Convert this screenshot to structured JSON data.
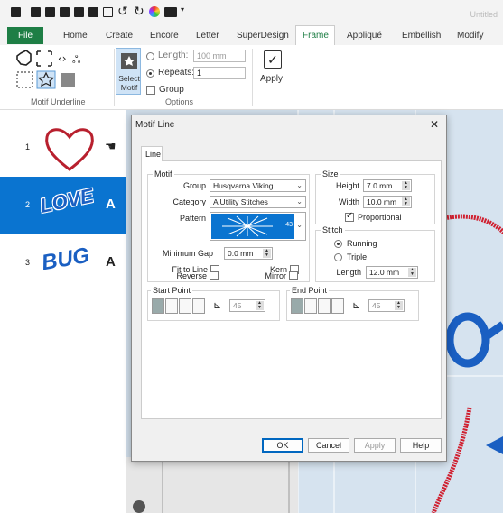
{
  "app": {
    "title": "Untitled",
    "quick_access_icons": [
      "app-icon",
      "new-icon",
      "open-icon",
      "save-icon",
      "save-as-icon",
      "print-icon",
      "paste-icon",
      "undo-icon",
      "redo-icon",
      "color-icon",
      "frame-icon",
      "dropdown-icon"
    ]
  },
  "ribbon": {
    "tabs": [
      {
        "label": "File"
      },
      {
        "label": "Home"
      },
      {
        "label": "Create"
      },
      {
        "label": "Encore"
      },
      {
        "label": "Letter"
      },
      {
        "label": "SuperDesign"
      },
      {
        "label": "Frame"
      },
      {
        "label": "Appliqué"
      },
      {
        "label": "Embellish"
      },
      {
        "label": "Modify"
      }
    ],
    "active_tab": "Frame",
    "groups": {
      "motif_underline": "Motif Underline",
      "select_motif": "Select\nMotif",
      "options": "Options"
    },
    "options": {
      "length_label": "Length:",
      "length_value": "100 mm",
      "repeats_label": "Repeats:",
      "repeats_value": "1",
      "group_label": "Group"
    },
    "apply_label": "Apply"
  },
  "objects": [
    {
      "index": "1",
      "name": "heart",
      "icon": "touch-icon"
    },
    {
      "index": "2",
      "name": "LOVE",
      "type": "A",
      "selected": true
    },
    {
      "index": "3",
      "name": "BUG",
      "type": "A"
    }
  ],
  "dialog": {
    "title": "Motif Line",
    "close": "✕",
    "tab": "Line",
    "motif": {
      "legend": "Motif",
      "group_label": "Group",
      "group_value": "Husqvarna Viking",
      "category_label": "Category",
      "category_value": "A Utility Stitches",
      "pattern_label": "Pattern",
      "pattern_number": "43",
      "min_gap_label": "Minimum Gap",
      "min_gap_value": "0.0 mm",
      "fit_to_line": "Fit to Line",
      "kern": "Kern",
      "reverse": "Reverse",
      "mirror": "Mirror"
    },
    "size": {
      "legend": "Size",
      "height_label": "Height",
      "height_value": "7.0 mm",
      "width_label": "Width",
      "width_value": "10.0 mm",
      "proportional": "Proportional"
    },
    "stitch": {
      "legend": "Stitch",
      "running": "Running",
      "triple": "Triple",
      "length_label": "Length",
      "length_value": "12.0 mm"
    },
    "start_point": {
      "legend": "Start Point",
      "angle": "45"
    },
    "end_point": {
      "legend": "End Point",
      "angle": "45"
    },
    "buttons": {
      "ok": "OK",
      "cancel": "Cancel",
      "apply": "Apply",
      "help": "Help"
    }
  },
  "colors": {
    "file_tab": "#1e7e45",
    "selected_row": "#0a74d0",
    "heart": "#b8202e",
    "text_blue": "#1a5fc2",
    "accent": "#0067c0"
  }
}
